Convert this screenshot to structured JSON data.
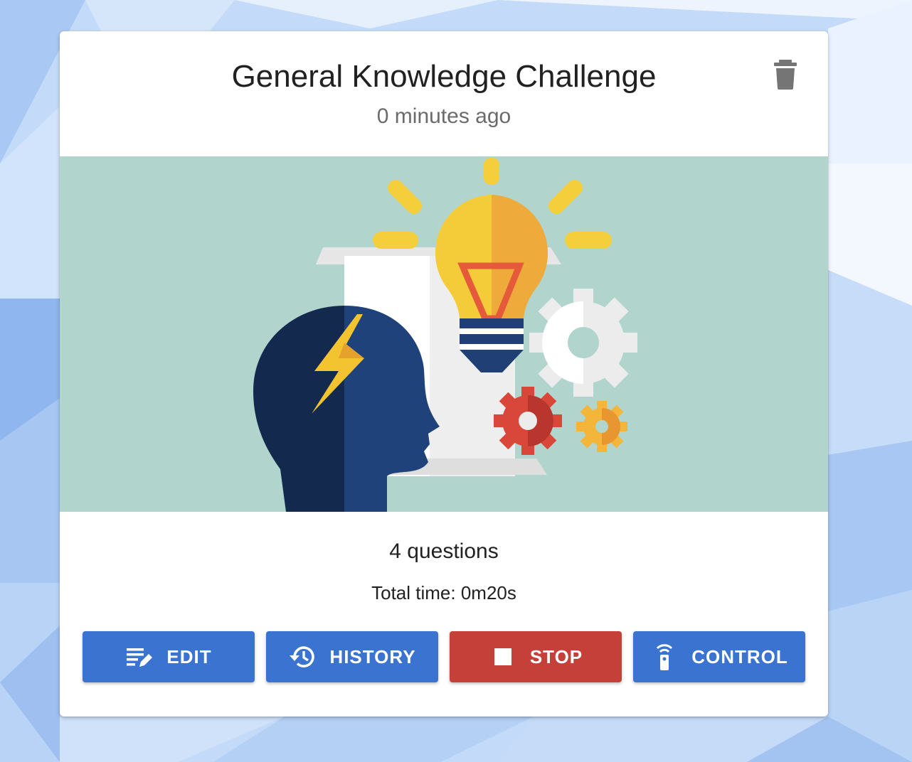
{
  "quiz": {
    "title": "General Knowledge Challenge",
    "created": "0 minutes ago",
    "question_count": "4 questions",
    "total_time": "Total time: 0m20s"
  },
  "actions": {
    "edit_label": "EDIT",
    "history_label": "HISTORY",
    "stop_label": "STOP",
    "control_label": "CONTROL"
  },
  "icons": {
    "delete": "trash-icon",
    "edit": "edit-list-icon",
    "history": "history-icon",
    "stop": "stop-square-icon",
    "control": "remote-control-icon"
  },
  "colors": {
    "primary_button": "#3a74d0",
    "stop_button": "#c6403a",
    "image_background": "#b1d5cc",
    "page_background": "#bcd6f7"
  }
}
